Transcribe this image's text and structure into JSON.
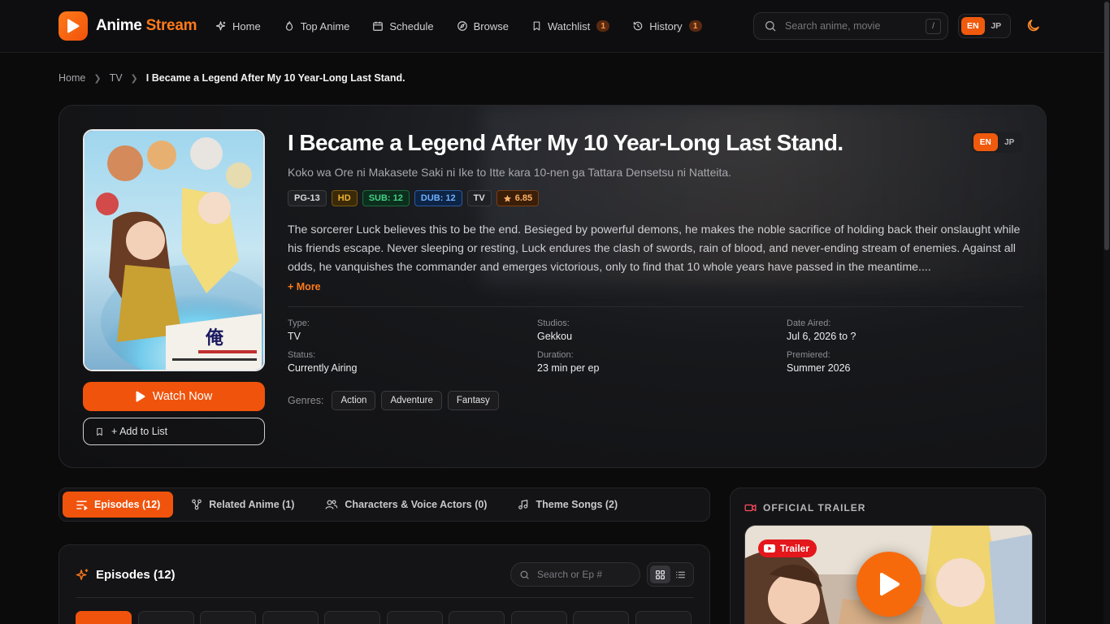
{
  "brand": {
    "name_primary": "Anime",
    "name_accent": "Stream"
  },
  "nav": {
    "items": [
      {
        "label": "Home",
        "icon": "sparkle-icon"
      },
      {
        "label": "Top Anime",
        "icon": "flame-icon"
      },
      {
        "label": "Schedule",
        "icon": "calendar-icon"
      },
      {
        "label": "Browse",
        "icon": "compass-icon"
      },
      {
        "label": "Watchlist",
        "icon": "bookmark-icon",
        "badge": "1"
      },
      {
        "label": "History",
        "icon": "history-icon",
        "badge": "1"
      }
    ],
    "search_placeholder": "Search anime, movie",
    "search_shortcut": "/",
    "lang": {
      "en": "EN",
      "jp": "JP",
      "selected": "EN"
    }
  },
  "breadcrumb": {
    "home": "Home",
    "category": "TV",
    "current": "I Became a Legend After My 10 Year-Long Last Stand."
  },
  "anime": {
    "title": "I Became a Legend After My 10 Year-Long Last Stand.",
    "alt_title": "Koko wa Ore ni Makasete Saki ni Ike to Itte kara 10-nen ga Tattara Densetsu ni Natteita.",
    "tags": {
      "rating": "PG-13",
      "quality": "HD",
      "sub": "SUB: 12",
      "dub": "DUB: 12",
      "type": "TV",
      "score": "6.85"
    },
    "synopsis": "The sorcerer Luck believes this to be the end. Besieged by powerful demons, he makes the noble sacrifice of holding back their onslaught while his friends escape. Never sleeping or resting, Luck endures the clash of swords, rain of blood, and never-ending stream of enemies. Against all odds, he vanquishes the commander and emerges victorious, only to find that 10 whole years have passed in the meantime....",
    "more_label": "+ More",
    "watch_label": "Watch Now",
    "add_label": "+ Add to List",
    "details": {
      "type_label": "Type:",
      "type": "TV",
      "studios_label": "Studios:",
      "studios": "Gekkou",
      "aired_label": "Date Aired:",
      "aired": "Jul 6, 2026 to ?",
      "status_label": "Status:",
      "status": "Currently Airing",
      "duration_label": "Duration:",
      "duration": "23 min per ep",
      "premiered_label": "Premiered:",
      "premiered": "Summer 2026"
    },
    "genres_label": "Genres:",
    "genres": [
      "Action",
      "Adventure",
      "Fantasy"
    ]
  },
  "tabs": [
    {
      "label": "Episodes (12)",
      "active": true
    },
    {
      "label": "Related Anime (1)"
    },
    {
      "label": "Characters & Voice Actors (0)"
    },
    {
      "label": "Theme Songs (2)"
    }
  ],
  "episodes": {
    "title": "Episodes (12)",
    "search_placeholder": "Search or Ep #"
  },
  "trailer": {
    "heading": "OFFICIAL TRAILER",
    "badge": "Trailer"
  },
  "colors": {
    "accent": "#f0530c",
    "background": "#0b0b0c",
    "card": "#141416"
  }
}
